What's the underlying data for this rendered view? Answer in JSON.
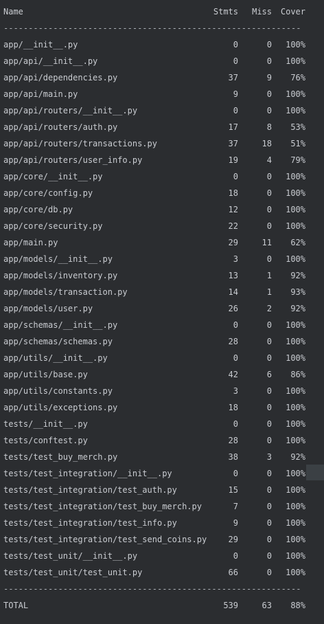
{
  "header": {
    "name": "Name",
    "stmts": "Stmts",
    "miss": "Miss",
    "cover": "Cover"
  },
  "separator": "------------------------------------------------------------",
  "rows": [
    {
      "name": "app/__init__.py",
      "stmts": "0",
      "miss": "0",
      "cover": "100%"
    },
    {
      "name": "app/api/__init__.py",
      "stmts": "0",
      "miss": "0",
      "cover": "100%"
    },
    {
      "name": "app/api/dependencies.py",
      "stmts": "37",
      "miss": "9",
      "cover": "76%"
    },
    {
      "name": "app/api/main.py",
      "stmts": "9",
      "miss": "0",
      "cover": "100%"
    },
    {
      "name": "app/api/routers/__init__.py",
      "stmts": "0",
      "miss": "0",
      "cover": "100%"
    },
    {
      "name": "app/api/routers/auth.py",
      "stmts": "17",
      "miss": "8",
      "cover": "53%"
    },
    {
      "name": "app/api/routers/transactions.py",
      "stmts": "37",
      "miss": "18",
      "cover": "51%"
    },
    {
      "name": "app/api/routers/user_info.py",
      "stmts": "19",
      "miss": "4",
      "cover": "79%"
    },
    {
      "name": "app/core/__init__.py",
      "stmts": "0",
      "miss": "0",
      "cover": "100%"
    },
    {
      "name": "app/core/config.py",
      "stmts": "18",
      "miss": "0",
      "cover": "100%"
    },
    {
      "name": "app/core/db.py",
      "stmts": "12",
      "miss": "0",
      "cover": "100%"
    },
    {
      "name": "app/core/security.py",
      "stmts": "22",
      "miss": "0",
      "cover": "100%"
    },
    {
      "name": "app/main.py",
      "stmts": "29",
      "miss": "11",
      "cover": "62%"
    },
    {
      "name": "app/models/__init__.py",
      "stmts": "3",
      "miss": "0",
      "cover": "100%"
    },
    {
      "name": "app/models/inventory.py",
      "stmts": "13",
      "miss": "1",
      "cover": "92%"
    },
    {
      "name": "app/models/transaction.py",
      "stmts": "14",
      "miss": "1",
      "cover": "93%"
    },
    {
      "name": "app/models/user.py",
      "stmts": "26",
      "miss": "2",
      "cover": "92%"
    },
    {
      "name": "app/schemas/__init__.py",
      "stmts": "0",
      "miss": "0",
      "cover": "100%"
    },
    {
      "name": "app/schemas/schemas.py",
      "stmts": "28",
      "miss": "0",
      "cover": "100%"
    },
    {
      "name": "app/utils/__init__.py",
      "stmts": "0",
      "miss": "0",
      "cover": "100%"
    },
    {
      "name": "app/utils/base.py",
      "stmts": "42",
      "miss": "6",
      "cover": "86%"
    },
    {
      "name": "app/utils/constants.py",
      "stmts": "3",
      "miss": "0",
      "cover": "100%"
    },
    {
      "name": "app/utils/exceptions.py",
      "stmts": "18",
      "miss": "0",
      "cover": "100%"
    },
    {
      "name": "tests/__init__.py",
      "stmts": "0",
      "miss": "0",
      "cover": "100%"
    },
    {
      "name": "tests/conftest.py",
      "stmts": "28",
      "miss": "0",
      "cover": "100%"
    },
    {
      "name": "tests/test_buy_merch.py",
      "stmts": "38",
      "miss": "3",
      "cover": "92%"
    },
    {
      "name": "tests/test_integration/__init__.py",
      "stmts": "0",
      "miss": "0",
      "cover": "100%"
    },
    {
      "name": "tests/test_integration/test_auth.py",
      "stmts": "15",
      "miss": "0",
      "cover": "100%"
    },
    {
      "name": "tests/test_integration/test_buy_merch.py",
      "stmts": "7",
      "miss": "0",
      "cover": "100%"
    },
    {
      "name": "tests/test_integration/test_info.py",
      "stmts": "9",
      "miss": "0",
      "cover": "100%"
    },
    {
      "name": "tests/test_integration/test_send_coins.py",
      "stmts": "29",
      "miss": "0",
      "cover": "100%"
    },
    {
      "name": "tests/test_unit/__init__.py",
      "stmts": "0",
      "miss": "0",
      "cover": "100%"
    },
    {
      "name": "tests/test_unit/test_unit.py",
      "stmts": "66",
      "miss": "0",
      "cover": "100%"
    }
  ],
  "total": {
    "name": "TOTAL",
    "stmts": "539",
    "miss": "63",
    "cover": "88%"
  },
  "colors": {
    "background": "#2b2d30",
    "text": "#c9ccd1"
  }
}
